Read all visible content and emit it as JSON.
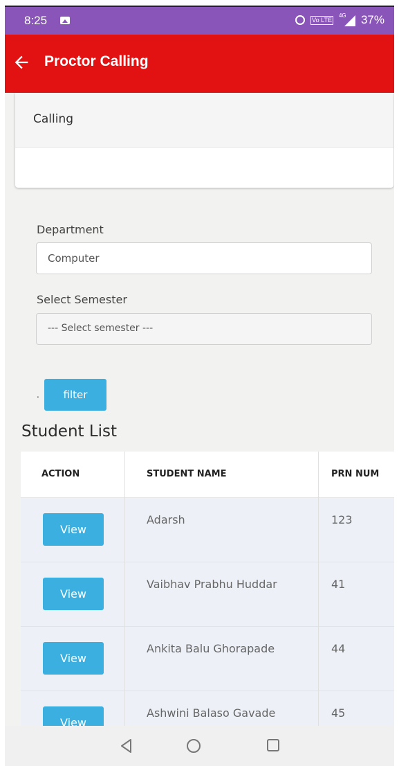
{
  "status_bar": {
    "time": "8:25",
    "battery": "37%",
    "network": "4G",
    "volte": "Vo LTE"
  },
  "app_bar": {
    "title": "Proctor Calling",
    "color": "#e31212"
  },
  "card": {
    "header": "Calling"
  },
  "form": {
    "department_label": "Department",
    "department_value": "Computer",
    "semester_label": "Select Semester",
    "semester_value": "--- Select semester ---",
    "dot": ".",
    "filter_label": "filter"
  },
  "student_list": {
    "title": "Student List",
    "columns": [
      "ACTION",
      "STUDENT NAME",
      "PRN NUM"
    ],
    "rows": [
      {
        "action": "View",
        "name": "Adarsh",
        "prn": "123"
      },
      {
        "action": "View",
        "name": "Vaibhav Prabhu Huddar",
        "prn": "41"
      },
      {
        "action": "View",
        "name": "Ankita Balu Ghorapade",
        "prn": "44"
      },
      {
        "action": "View",
        "name": "Ashwini Balaso Gavade",
        "prn": "45"
      }
    ]
  },
  "icons": [
    "image-icon",
    "alarm-icon",
    "volte-icon",
    "signal-icon",
    "back-arrow-icon",
    "nav-back-icon",
    "nav-home-icon",
    "nav-recents-icon"
  ],
  "colors": {
    "status_bar": "#8a55b8",
    "accent": "#3bb0e0"
  }
}
